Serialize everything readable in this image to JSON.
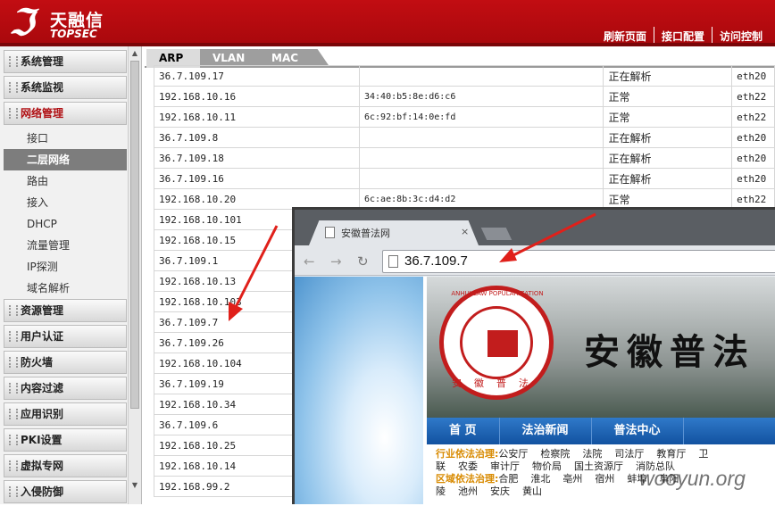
{
  "header": {
    "logo_cn": "天融信",
    "logo_en": "TOPSEC",
    "nav": [
      "刷新页面",
      "接口配置",
      "访问控制"
    ]
  },
  "sidebar": {
    "groups": [
      {
        "label": "系统管理"
      },
      {
        "label": "系统监视"
      },
      {
        "label": "网络管理",
        "open": true,
        "items": [
          {
            "label": "接口"
          },
          {
            "label": "二层网络",
            "active": true
          },
          {
            "label": "路由"
          },
          {
            "label": "接入"
          },
          {
            "label": "DHCP"
          },
          {
            "label": "流量管理"
          },
          {
            "label": "IP探测"
          },
          {
            "label": "域名解析"
          }
        ]
      },
      {
        "label": "资源管理"
      },
      {
        "label": "用户认证"
      },
      {
        "label": "防火墙"
      },
      {
        "label": "内容过滤"
      },
      {
        "label": "应用识别"
      },
      {
        "label": "PKI设置"
      },
      {
        "label": "虚拟专网"
      },
      {
        "label": "入侵防御"
      }
    ]
  },
  "tabs": [
    {
      "label": "ARP",
      "active": true
    },
    {
      "label": "VLAN"
    },
    {
      "label": "MAC"
    }
  ],
  "arp_table": {
    "rows": [
      [
        "36.7.109.17",
        "",
        "正在解析",
        "eth20"
      ],
      [
        "192.168.10.16",
        "34:40:b5:8e:d6:c6",
        "正常",
        "eth22"
      ],
      [
        "192.168.10.11",
        "6c:92:bf:14:0e:fd",
        "正常",
        "eth22"
      ],
      [
        "36.7.109.8",
        "",
        "正在解析",
        "eth20"
      ],
      [
        "36.7.109.18",
        "",
        "正在解析",
        "eth20"
      ],
      [
        "36.7.109.16",
        "",
        "正在解析",
        "eth20"
      ],
      [
        "192.168.10.20",
        "6c:ae:8b:3c:d4:d2",
        "正常",
        "eth22"
      ],
      [
        "192.168.10.101",
        "",
        "",
        ""
      ],
      [
        "192.168.10.15",
        "",
        "",
        ""
      ],
      [
        "36.7.109.1",
        "",
        "",
        ""
      ],
      [
        "192.168.10.13",
        "",
        "",
        ""
      ],
      [
        "192.168.10.103",
        "",
        "",
        ""
      ],
      [
        "36.7.109.7",
        "",
        "",
        ""
      ],
      [
        "36.7.109.26",
        "",
        "",
        ""
      ],
      [
        "192.168.10.104",
        "",
        "",
        ""
      ],
      [
        "36.7.109.19",
        "",
        "",
        ""
      ],
      [
        "192.168.10.34",
        "",
        "",
        ""
      ],
      [
        "36.7.109.6",
        "",
        "",
        ""
      ],
      [
        "192.168.10.25",
        "",
        "",
        ""
      ],
      [
        "192.168.10.14",
        "",
        "",
        ""
      ],
      [
        "192.168.99.2",
        "",
        "",
        ""
      ]
    ]
  },
  "browser": {
    "tab_title": "安徽普法网",
    "tab_close": "×",
    "url": "36.7.109.7",
    "seal_text": "ANHUI LAW POPULARIZATION",
    "seal_bottom": "安徽普法",
    "site_title": "安徽普法",
    "nav": [
      "首 页",
      "法治新闻",
      "普法中心"
    ],
    "links": [
      {
        "label": "行业依法治理:",
        "items": [
          "公安厅",
          "检察院",
          "法院",
          "司法厅",
          "教育厅",
          "卫"
        ]
      },
      {
        "label": "",
        "items": [
          "联",
          "农委",
          "审计厅",
          "物价局",
          "国土资源厅",
          "消防总队"
        ]
      },
      {
        "label": "区域依法治理:",
        "items": [
          "合肥",
          "淮北",
          "亳州",
          "宿州",
          "蚌埠",
          "阜阳"
        ]
      },
      {
        "label": "",
        "items": [
          "陵",
          "池州",
          "安庆",
          "黄山"
        ]
      }
    ]
  },
  "watermark": "wooyun.org",
  "colors": {
    "header_red": "#c20d12",
    "active_menu": "#7d7d7d",
    "arrow_red": "#e0201a",
    "browser_nav_blue": "#1f64b5"
  }
}
